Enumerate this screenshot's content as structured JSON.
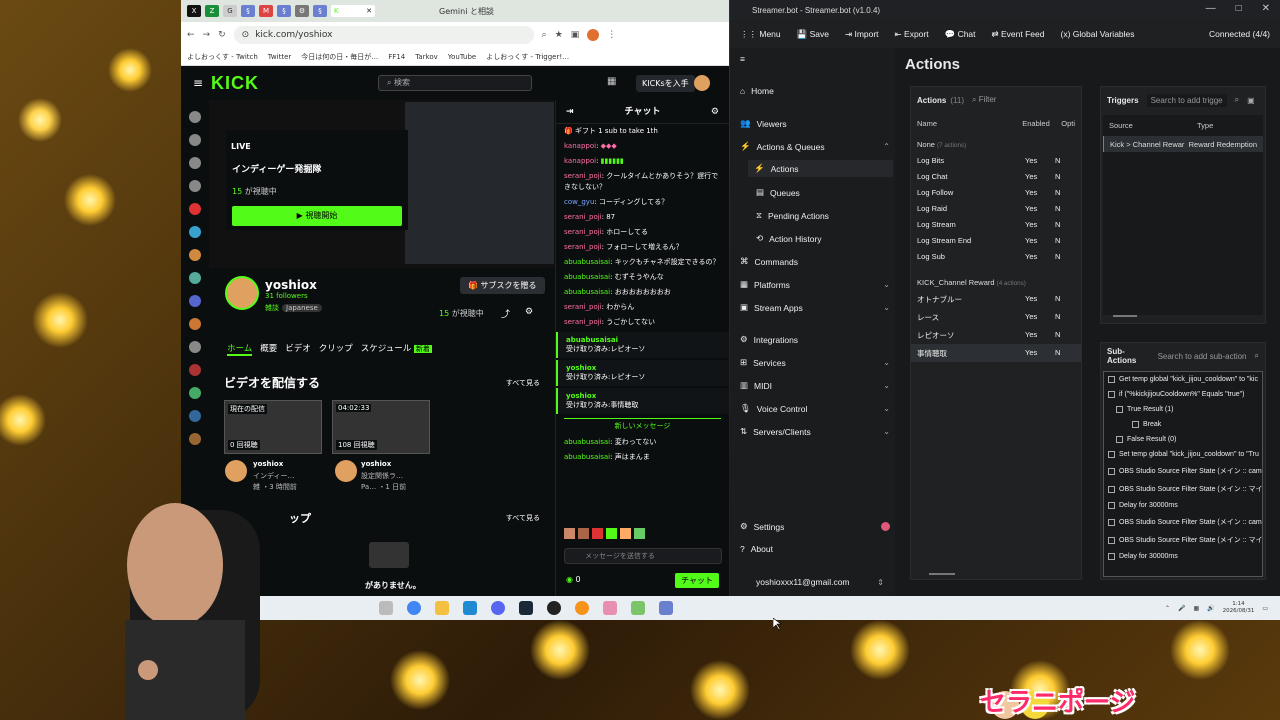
{
  "browser": {
    "tab_gemini": "Gemini と相談",
    "url": "kick.com/yoshiox",
    "bookmarks": [
      "よしおっくす - Twitch",
      "Twitter",
      "今日は何の日・毎日が…",
      "FF14",
      "Tarkov",
      "YouTube",
      "よしおっくす - Trigger!…"
    ]
  },
  "kick": {
    "logo": "KICK",
    "search_placeholder": "検索",
    "kicks_button": "KICKsを入手",
    "live_badge": "LIVE",
    "stream_title": "インディーゲー発掘隊",
    "viewers": "15",
    "viewers_label": "が視聴中",
    "watch_button": "視聴開始",
    "channel_name": "yoshiox",
    "followers": "31 followers",
    "tag1": "雑談",
    "tag2": "Japanese",
    "subscribe_button": "サブスクを贈る",
    "watching": "15",
    "watching_label": "が視聴中",
    "tabs": [
      "ホーム",
      "概要",
      "ビデオ",
      "クリップ",
      "スケジュール"
    ],
    "new_badge": "新着",
    "videos_heading": "ビデオを配信する",
    "see_all": "すべて見る",
    "videos": [
      {
        "label": "現在の配信",
        "views": "0 回視聴",
        "author": "yoshiox",
        "title": "インディー…",
        "meta": "雑 ・3 時間前"
      },
      {
        "label": "04:02:33",
        "views": "108 回視聴",
        "author": "yoshiox",
        "title": "設定関係ラ…",
        "meta": "Pa… ・1 日前"
      }
    ],
    "clips_heading": "ップ",
    "clips_see_all": "すべて見る",
    "no_clips": "がありません。"
  },
  "chat": {
    "title": "チャット",
    "gift": "ギフト 1 sub to take 1th",
    "messages": [
      {
        "name": "kanappoi",
        "text": "",
        "color": "p"
      },
      {
        "name": "kanappoi",
        "text": "",
        "color": "p"
      },
      {
        "name": "serani_poji",
        "text": "クールタイムとかありそう？遅行できなしない？",
        "color": "p"
      },
      {
        "name": "cow_gyu",
        "text": "コーディングしてる？",
        "color": "b"
      },
      {
        "name": "serani_poji",
        "text": "87",
        "color": "p"
      },
      {
        "name": "serani_poji",
        "text": "ホローしてる",
        "color": "p"
      },
      {
        "name": "serani_poji",
        "text": "フォローして増えるん？",
        "color": "p"
      },
      {
        "name": "abuabusaisai",
        "text": "キックもチャネポ設定できるの？",
        "color": "g"
      },
      {
        "name": "abuabusaisai",
        "text": "むずそうやんな",
        "color": "g"
      },
      {
        "name": "abuabusaisai",
        "text": "おおおおおおおお",
        "color": "g"
      },
      {
        "name": "serani_poji",
        "text": "わからん",
        "color": "p"
      },
      {
        "name": "serani_poji",
        "text": "うごかしてない",
        "color": "p"
      }
    ],
    "redeems": [
      {
        "name": "abuabusaisai",
        "text": "受け取り済み:レピオーソ"
      },
      {
        "name": "yoshiox",
        "text": "受け取り済み:レピオーソ"
      },
      {
        "name": "yoshiox",
        "text": "受け取り済み:事情聴取"
      }
    ],
    "new_messages": "新しいメッセージ",
    "after": [
      {
        "name": "abuabusaisai",
        "text": "変わってない",
        "color": "g"
      },
      {
        "name": "abuabusaisai",
        "text": "声はまんま",
        "color": "g"
      }
    ],
    "input_placeholder": "メッセージを送信する",
    "points": "0",
    "send_button": "チャット"
  },
  "sb": {
    "title": "Streamer.bot - Streamer.bot (v1.0.4)",
    "menu": [
      "Menu",
      "Save",
      "Import",
      "Export",
      "Chat",
      "Event Feed",
      "Global Variables"
    ],
    "connected": "Connected (4/4)",
    "nav": {
      "home": "Home",
      "viewers": "Viewers",
      "actions_queues": "Actions & Queues",
      "actions": "Actions",
      "queues": "Queues",
      "pending": "Pending Actions",
      "history": "Action History",
      "commands": "Commands",
      "platforms": "Platforms",
      "stream_apps": "Stream Apps",
      "integrations": "Integrations",
      "services": "Services",
      "midi": "MIDI",
      "voice": "Voice Control",
      "servers": "Servers/Clients",
      "settings": "Settings",
      "about": "About",
      "account": "yoshioxxx11@gmail.com"
    },
    "page_title": "Actions",
    "actions_label": "Actions",
    "actions_count": "(11)",
    "filter_placeholder": "Filter",
    "col_name": "Name",
    "col_enabled": "Enabled",
    "col_opt": "Opti",
    "group_none": "None",
    "group_none_count": "(7 actions)",
    "actions": [
      {
        "name": "Log Bits",
        "en": "Yes",
        "o": "N"
      },
      {
        "name": "Log Chat",
        "en": "Yes",
        "o": "N"
      },
      {
        "name": "Log Follow",
        "en": "Yes",
        "o": "N"
      },
      {
        "name": "Log Raid",
        "en": "Yes",
        "o": "N"
      },
      {
        "name": "Log Stream",
        "en": "Yes",
        "o": "N"
      },
      {
        "name": "Log Stream End",
        "en": "Yes",
        "o": "N"
      },
      {
        "name": "Log Sub",
        "en": "Yes",
        "o": "N"
      }
    ],
    "group_kick": "KICK_Channel Reward",
    "group_kick_count": "(4 actions)",
    "kick_actions": [
      {
        "name": "オトナブルー",
        "en": "Yes",
        "o": "N"
      },
      {
        "name": "レース",
        "en": "Yes",
        "o": "N"
      },
      {
        "name": "レピオーソ",
        "en": "Yes",
        "o": "N"
      },
      {
        "name": "事情聴取",
        "en": "Yes",
        "o": "N"
      }
    ],
    "triggers_label": "Triggers",
    "triggers_placeholder": "Search to add trigge",
    "trig_col_source": "Source",
    "trig_col_type": "Type",
    "trigger_source": "Kick > Channel Rewar",
    "trigger_type": "Reward Redemption",
    "subactions_label": "Sub-Actions",
    "subactions_placeholder": "Search to add sub-action",
    "subactions": [
      "Get temp global \"kick_jijou_cooldown\" to \"kic",
      "if (\"%kickjijouCooldown%\" Equals \"true\")",
      "True Result (1)",
      "Break",
      "False Result (0)",
      "Set temp global \"kick_jijou_cooldown\" to \"Tru",
      "OBS Studio Source Filter State (メイン :: cam2",
      "OBS Studio Source Filter State (メイン :: マイク",
      "Delay for 30000ms",
      "OBS Studio Source Filter State (メイン :: cam2",
      "OBS Studio Source Filter State (メイン :: マイク",
      "Delay for 30000ms"
    ]
  },
  "taskbar": {
    "time": "1:14",
    "date": "2026/08/31"
  },
  "overlay_name": "セラニポージ"
}
